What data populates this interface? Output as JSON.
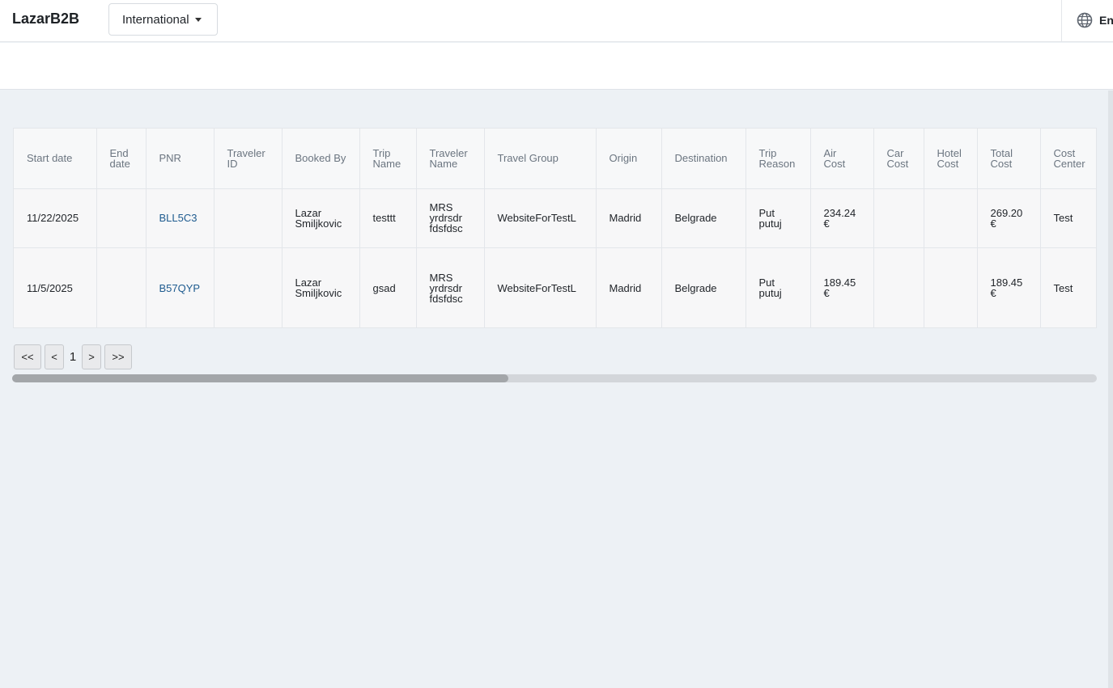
{
  "header": {
    "brand": "LazarB2B",
    "region_select": "International",
    "language": "English"
  },
  "table": {
    "columns": [
      "Start date",
      "End date",
      "PNR",
      "Traveler ID",
      "Booked By",
      "Trip Name",
      "Traveler Name",
      "Travel Group",
      "Origin",
      "Destination",
      "Trip Reason",
      "Air Cost",
      "Car Cost",
      "Hotel Cost",
      "Total Cost",
      "Cost Center"
    ],
    "rows": [
      {
        "start_date": "11/22/2025",
        "end_date": "",
        "pnr": "BLL5C3",
        "traveler_id": "",
        "booked_by": "Lazar Smiljkovic",
        "trip_name": "testtt",
        "traveler_name": "MRS yrdrsdr fdsfdsc",
        "travel_group": "WebsiteForTestL",
        "origin": "Madrid",
        "destination": "Belgrade",
        "trip_reason": "Put putuj",
        "air_cost": "234.24 €",
        "car_cost": "",
        "hotel_cost": "",
        "total_cost": "269.20 €",
        "cost_center": "Test"
      },
      {
        "start_date": "11/5/2025",
        "end_date": "",
        "pnr": "B57QYP",
        "traveler_id": "",
        "booked_by": "Lazar Smiljkovic",
        "trip_name": "gsad",
        "traveler_name": "MRS yrdrsdr fdsfdsc",
        "travel_group": "WebsiteForTestL",
        "origin": "Madrid",
        "destination": "Belgrade",
        "trip_reason": "Put putuj",
        "air_cost": "189.45 €",
        "car_cost": "",
        "hotel_cost": "",
        "total_cost": "189.45 €",
        "cost_center": "Test"
      }
    ]
  },
  "pagination": {
    "first": "<<",
    "prev": "<",
    "current": "1",
    "next": ">",
    "last": ">>"
  },
  "colors": {
    "link": "#1e5b8f",
    "background": "#edf1f5"
  }
}
